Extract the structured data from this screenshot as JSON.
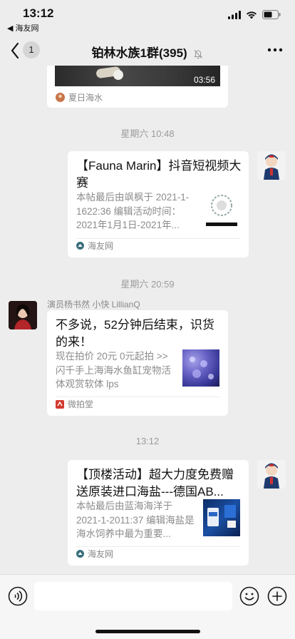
{
  "status_bar": {
    "time": "13:12",
    "back_app": "◀ 海友网"
  },
  "nav": {
    "badge_count": "1",
    "title": "铂林水族1群(395)"
  },
  "messages": {
    "video_card": {
      "duration": "03:56",
      "source": "夏日海水"
    },
    "timestamp_1": "星期六 10:48",
    "card_1": {
      "title": "【Fauna Marin】抖音短视频大赛",
      "desc": "本帖最后由飒枫于 2021-1-1622:36 编辑活动时间：2021年1月1日-2021年...",
      "source": "海友网"
    },
    "timestamp_2": "星期六 20:59",
    "card_2": {
      "sender": "演员杨书然 小快 LillianQ",
      "title": "不多说，52分钟后结束，识货的来！",
      "desc": "现在拍价 20元 0元起拍 >> 闪千手上海海水鱼缸宠物活体观赏软体 lps",
      "source": "微拍堂"
    },
    "timestamp_3": "13:12",
    "card_3": {
      "title": "【顶楼活动】超大力度免费赠送原装进口海盐---德国AB...",
      "desc": "本帖最后由蓝海海洋于 2021-1-2011:37 编辑海盐是海水饲养中最为重要...",
      "source": "海友网"
    }
  },
  "colors": {
    "background": "#ededed",
    "card": "#ffffff",
    "secondary_text": "#8c8c8c"
  },
  "icons": [
    "back-chevron-icon",
    "mute-bell-icon",
    "more-dots-icon",
    "voice-icon",
    "emoji-icon",
    "plus-icon",
    "signal-icon",
    "wifi-icon",
    "battery-icon"
  ]
}
